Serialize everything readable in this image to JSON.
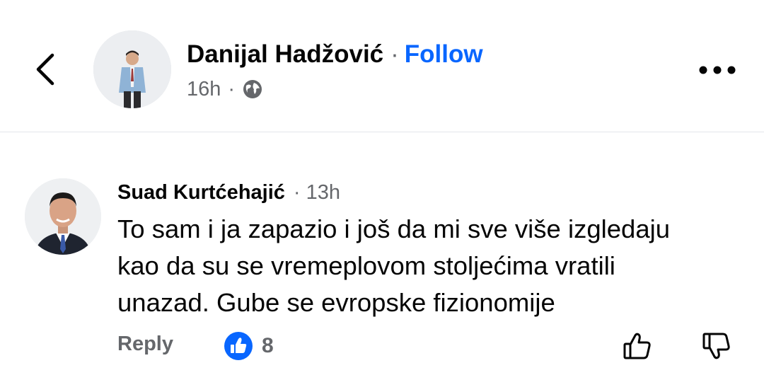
{
  "header": {
    "author_name": "Danijal Hadžović",
    "separator": "·",
    "follow_label": "Follow",
    "post_time": "16h",
    "meta_separator": "·",
    "icons": {
      "back": "chevron-left-icon",
      "privacy": "globe-icon",
      "more": "more-horizontal-icon"
    }
  },
  "comment": {
    "author_name": "Suad Kurtćehajić",
    "separator": "·",
    "time": "13h",
    "text_lines": [
      "To sam i ja zapazio i još da mi sve više izgledaju",
      "kao da su se vremeplovom stoljećima vratili",
      "unazad. Gube se evropske fizionomije"
    ],
    "reply_label": "Reply",
    "reaction": {
      "type": "like",
      "count": "8"
    },
    "icons": {
      "reaction": "like-reaction-icon",
      "upvote": "thumbs-up-icon",
      "downvote": "thumbs-down-icon"
    }
  },
  "colors": {
    "text_primary": "#050505",
    "text_secondary": "#65676b",
    "accent": "#0866ff",
    "divider": "#e4e6eb"
  }
}
